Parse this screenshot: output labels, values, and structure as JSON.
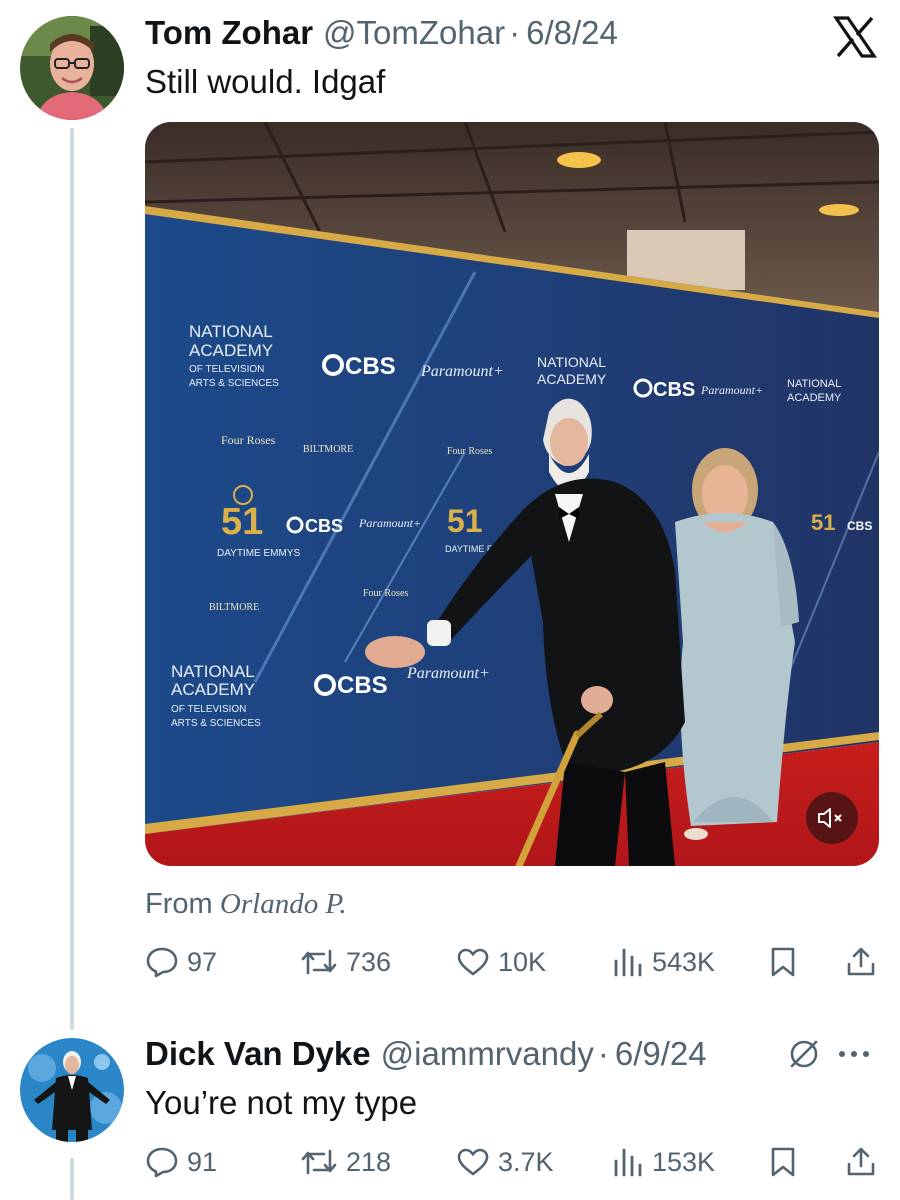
{
  "tweet1": {
    "display_name": "Tom Zohar",
    "handle": "@TomZohar",
    "separator": "·",
    "date": "6/8/24",
    "text": "Still would. Idgaf",
    "media_icon": "mute-icon",
    "from_label": "From",
    "from_name": "Orlando P.",
    "stats": {
      "replies": "97",
      "reposts": "736",
      "likes": "10K",
      "views": "543K"
    }
  },
  "tweet2": {
    "display_name": "Dick Van Dyke",
    "handle": "@iammrvandy",
    "separator": "·",
    "date": "6/9/24",
    "text": "You’re not my type",
    "stats": {
      "replies": "91",
      "reposts": "218",
      "likes": "3.7K",
      "views": "153K"
    }
  },
  "media_signage": {
    "academy": [
      "NATIONAL",
      "ACADEMY",
      "OF TELEVISION",
      "ARTS & SCIENCES"
    ],
    "cbs": "CBS",
    "paramount": "Paramount+",
    "fourroses": "Four Roses",
    "biltmore": "BILTMORE",
    "emmys_number": "51",
    "emmys_label": "DAYTIME EMMYS"
  },
  "colors": {
    "text_primary": "#0f1419",
    "text_secondary": "#536471",
    "thread_line": "#cfd9de",
    "backdrop_blue": "#1f4a86",
    "carpet_red": "#c0191c",
    "gold": "#d4a93c"
  }
}
